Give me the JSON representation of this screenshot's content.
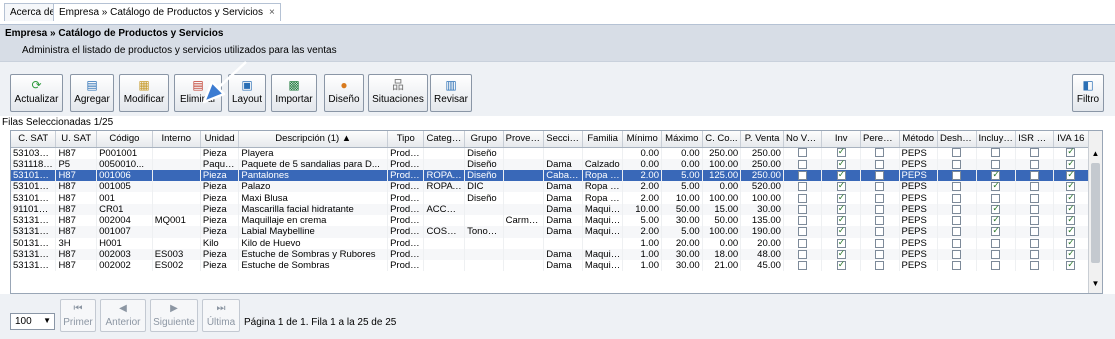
{
  "tabs": [
    {
      "label": "Acerca de"
    },
    {
      "label": "Empresa » Catálogo de Productos y Servicios",
      "close": "×"
    }
  ],
  "header": {
    "title": "Empresa » Catálogo de Productos y Servicios",
    "subtitle": "Administra el listado de productos y servicios utilizados para las ventas"
  },
  "toolbar": {
    "actualizar": "Actualizar",
    "agregar": "Agregar",
    "modificar": "Modificar",
    "eliminar": "Eliminar",
    "layout": "Layout",
    "importar": "Importar",
    "diseno": "Diseño",
    "situaciones": "Situaciones",
    "revisar": "Revisar",
    "filtro": "Filtro"
  },
  "selection_info": "Filas Seleccionadas  1/25",
  "table": {
    "columns": [
      "C. SAT",
      "U. SAT",
      "Código",
      "Interno",
      "Unidad",
      "Descripción (1) ▲",
      "Tipo",
      "Catego...",
      "Grupo",
      "Provee...",
      "Sección",
      "Familia",
      "Mínimo",
      "Máximo",
      "C. Co...",
      "P. Venta",
      "No Ve...",
      "Inv",
      "Perece...",
      "Método",
      "Desha...",
      "Incluye...",
      "ISR RET",
      "IVA 16"
    ],
    "rows": [
      [
        "53103001",
        "H87",
        "P001001",
        "",
        "Pieza",
        "Playera",
        "Produ...",
        "",
        "Diseño",
        "",
        "",
        "",
        "0.00",
        "0.00",
        "250.00",
        "250.00",
        false,
        true,
        false,
        "PEPS",
        false,
        false,
        false,
        true
      ],
      [
        "53111802",
        "P5",
        "0050010...",
        "",
        "Paquete",
        "Paquete de 5 sandalias para D...",
        "Produ...",
        "",
        "Diseño",
        "",
        "Dama",
        "Calzado",
        "0.00",
        "0.00",
        "100.00",
        "250.00",
        false,
        true,
        false,
        "PEPS",
        false,
        false,
        false,
        true
      ],
      [
        "53101502",
        "H87",
        "001006",
        "",
        "Pieza",
        "Pantalones",
        "Produ...",
        "ROPA ...",
        "Diseño",
        "",
        "Caball...",
        "Ropa C...",
        "2.00",
        "5.00",
        "125.00",
        "250.00",
        false,
        true,
        false,
        "PEPS",
        false,
        true,
        false,
        true
      ],
      [
        "53101504",
        "H87",
        "001005",
        "",
        "Pieza",
        "Palazo",
        "Produ...",
        "ROPA ...",
        "DIC",
        "",
        "Dama",
        "Ropa D...",
        "2.00",
        "5.00",
        "0.00",
        "520.00",
        false,
        true,
        false,
        "PEPS",
        false,
        true,
        false,
        true
      ],
      [
        "53101604",
        "H87",
        "001",
        "",
        "Pieza",
        "Maxi Blusa",
        "Produ...",
        "",
        "Diseño",
        "",
        "Dama",
        "Ropa D...",
        "2.00",
        "10.00",
        "100.00",
        "100.00",
        false,
        true,
        false,
        "PEPS",
        false,
        false,
        false,
        true
      ],
      [
        "91101600",
        "H87",
        "CR01",
        "",
        "Pieza",
        "Mascarilla facial hidratante",
        "Produ...",
        "ACCES...",
        "",
        "",
        "Dama",
        "Maquil...",
        "10.00",
        "50.00",
        "15.00",
        "30.00",
        false,
        true,
        false,
        "PEPS",
        false,
        true,
        false,
        true
      ],
      [
        "53131629",
        "H87",
        "002004",
        "MQ001",
        "Pieza",
        "Maquillaje en crema",
        "Produ...",
        "",
        "",
        "Carme...",
        "Dama",
        "Maquil...",
        "5.00",
        "30.00",
        "50.00",
        "135.00",
        false,
        true,
        false,
        "PEPS",
        false,
        true,
        false,
        true
      ],
      [
        "53131629",
        "H87",
        "001007",
        "",
        "Pieza",
        "Labial Maybelline",
        "Produ...",
        "COSM...",
        "Tonos ...",
        "",
        "Dama",
        "Maquil...",
        "2.00",
        "5.00",
        "100.00",
        "190.00",
        false,
        true,
        false,
        "PEPS",
        false,
        true,
        false,
        true
      ],
      [
        "50131612",
        "3H",
        "H001",
        "",
        "Kilo",
        "Kilo de Huevo",
        "Produ...",
        "",
        "",
        "",
        "",
        "",
        "1.00",
        "20.00",
        "0.00",
        "20.00",
        false,
        true,
        false,
        "PEPS",
        false,
        false,
        false,
        true
      ],
      [
        "53131629",
        "H87",
        "002003",
        "ES003",
        "Pieza",
        "Estuche de Sombras y Rubores",
        "Produ...",
        "",
        "",
        "",
        "Dama",
        "Maquil...",
        "1.00",
        "30.00",
        "18.00",
        "48.00",
        false,
        true,
        false,
        "PEPS",
        false,
        false,
        false,
        true
      ],
      [
        "53131629",
        "H87",
        "002002",
        "ES002",
        "Pieza",
        "Estuche de Sombras",
        "Produ...",
        "",
        "",
        "",
        "Dama",
        "Maquil...",
        "1.00",
        "30.00",
        "21.00",
        "45.00",
        false,
        true,
        false,
        "PEPS",
        false,
        false,
        false,
        true
      ]
    ]
  },
  "pager": {
    "primer": "Primer",
    "anterior": "Anterior",
    "siguiente": "Siguiente",
    "ultima": "Última",
    "page_size": "100",
    "info": "Página 1 de 1. Fila 1 a la 25 de 25"
  },
  "colors": {
    "selected_row": "#3968b8",
    "header_band": "#d7dde6",
    "toolbar_bg": "#eef1f5",
    "accent_icon": "#2a6fb5"
  }
}
